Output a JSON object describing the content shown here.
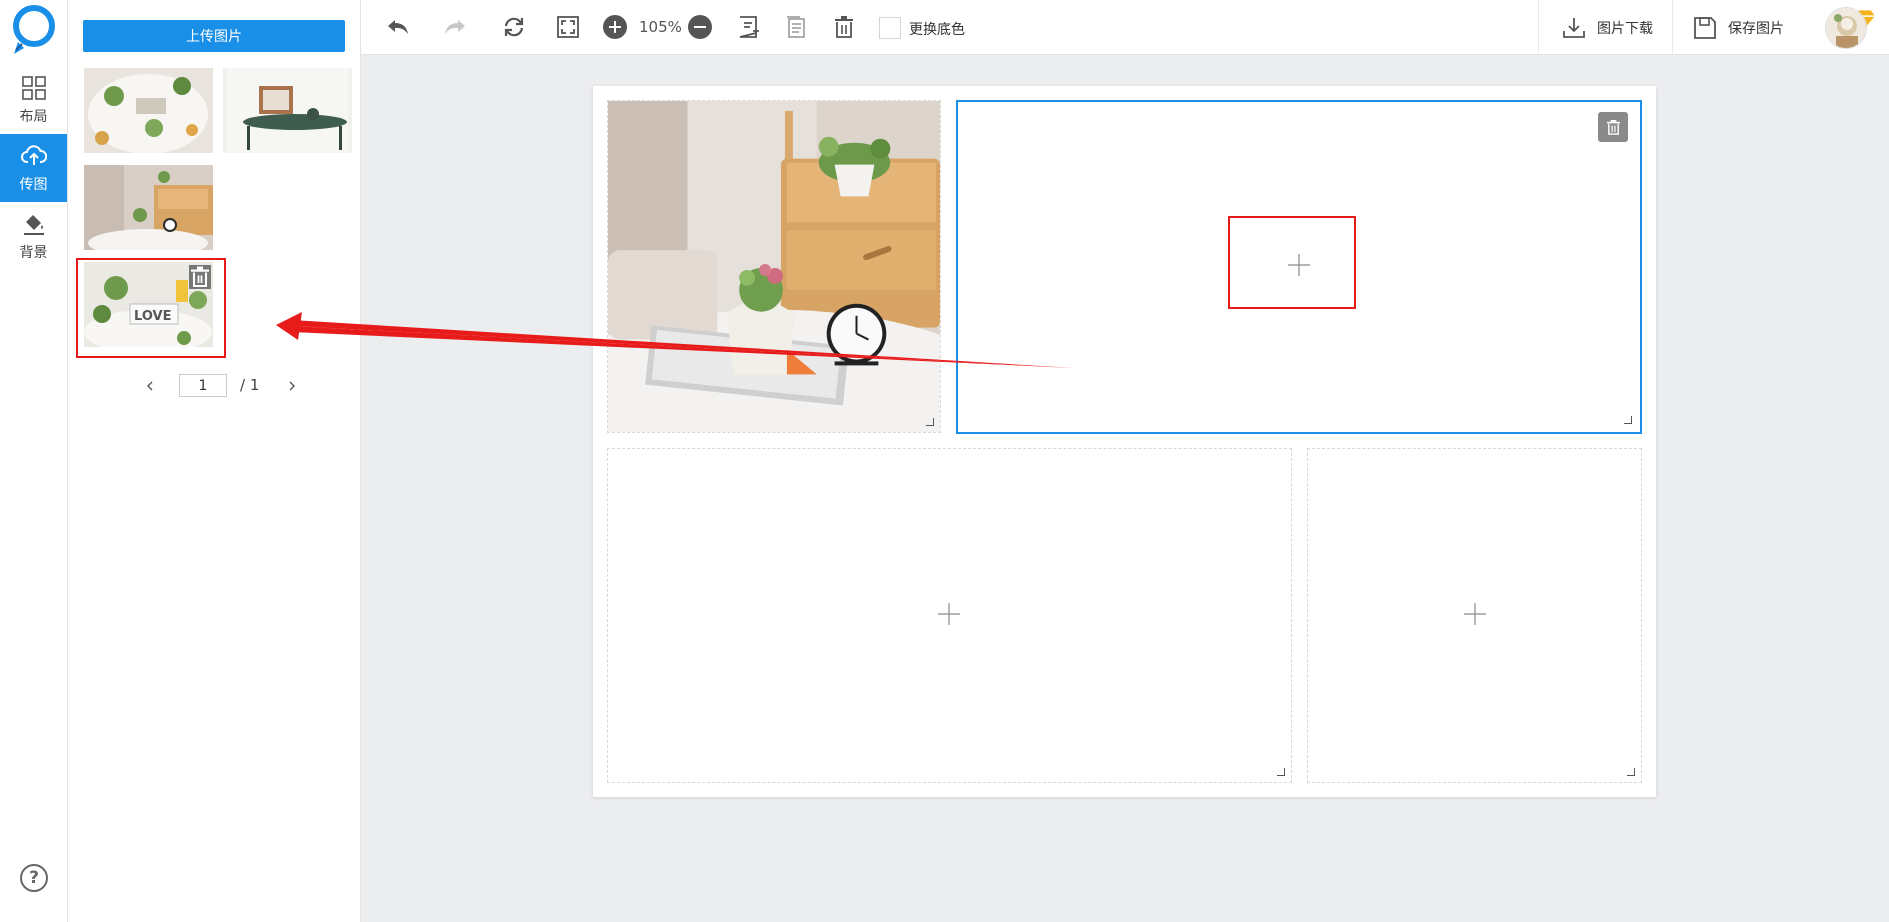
{
  "nav": {
    "items": [
      {
        "label": "布局",
        "icon": "grid-layout-icon"
      },
      {
        "label": "传图",
        "icon": "cloud-upload-icon"
      },
      {
        "label": "背景",
        "icon": "paint-bucket-icon"
      }
    ],
    "active_index": 1,
    "help_label": "?"
  },
  "panel": {
    "upload_label": "上传图片",
    "pager": {
      "current": "1",
      "total": "/ 1"
    }
  },
  "toolbar": {
    "zoom": "105%",
    "bg_color_label": "更换底色",
    "download_label": "图片下载",
    "save_label": "保存图片"
  },
  "colors": {
    "accent": "#1a8fe8",
    "highlight": "#e81b1b"
  }
}
